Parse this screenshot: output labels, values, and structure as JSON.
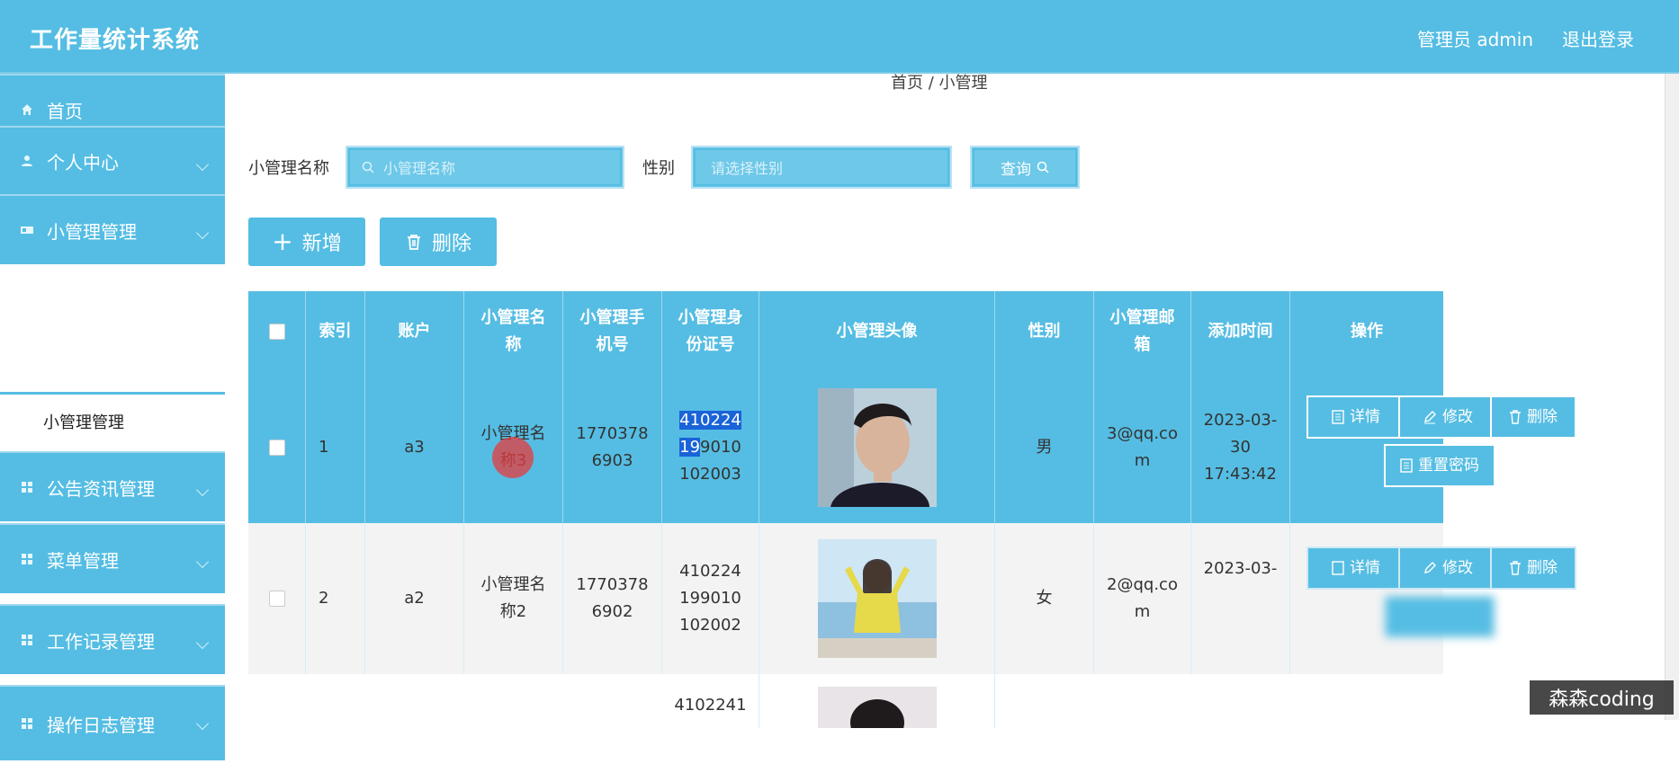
{
  "app": {
    "title": "工作量统计系统"
  },
  "header": {
    "user": "管理员 admin",
    "logout": "退出登录"
  },
  "sidebar": {
    "items": [
      {
        "label": "首页",
        "icon": "home-icon"
      },
      {
        "label": "个人中心",
        "icon": "user-icon"
      },
      {
        "label": "小管理管理",
        "icon": "card-icon"
      },
      {
        "label": "公告资讯管理",
        "icon": "grid-icon"
      },
      {
        "label": "菜单管理",
        "icon": "grid-icon"
      },
      {
        "label": "工作记录管理",
        "icon": "grid-icon"
      },
      {
        "label": "操作日志管理",
        "icon": "grid-icon"
      }
    ],
    "sub_item": "小管理管理"
  },
  "breadcrumb": "首页 / 小管理",
  "search": {
    "name_label": "小管理名称",
    "name_placeholder": "小管理名称",
    "gender_label": "性别",
    "gender_placeholder": "请选择性别",
    "query_label": "查询"
  },
  "actions": {
    "add_label": "新增",
    "delete_label": "删除"
  },
  "table": {
    "headers": [
      "索引",
      "账户",
      "小管理名称",
      "小管理手机号",
      "小管理身份证号",
      "小管理头像",
      "性别",
      "小管理邮箱",
      "添加时间",
      "操作"
    ],
    "rows": [
      {
        "index": "1",
        "account": "a3",
        "name": "小管理名称3",
        "phone": "17703786903",
        "id_selected": "41022419",
        "id_rest": "9010102003",
        "gender": "男",
        "email": "3@qq.com",
        "time": "2023-03-30 17:43:42"
      },
      {
        "index": "2",
        "account": "a2",
        "name": "小管理名称2",
        "phone": "17703786902",
        "id_card": "410224199010102002",
        "gender": "女",
        "email": "2@qq.com",
        "time": "2023-03-"
      },
      {
        "id_card": "4102241"
      }
    ],
    "op_labels": {
      "detail": "详情",
      "edit": "修改",
      "delete": "删除",
      "reset": "重置密码"
    }
  },
  "watermark": "森森coding",
  "colors": {
    "primary": "#55bde3",
    "selection": "#1a63d8"
  }
}
